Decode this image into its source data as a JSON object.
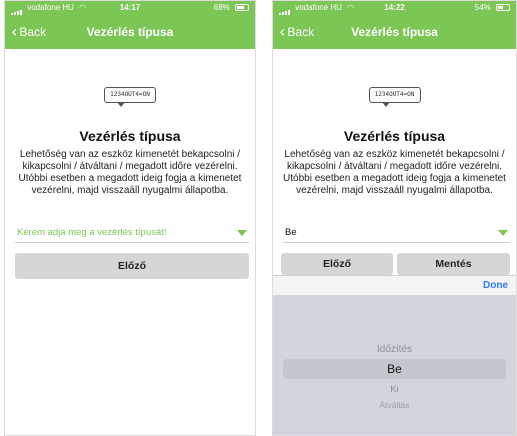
{
  "left": {
    "status": {
      "carrier": "vodafone HU",
      "time": "14:17",
      "battery": "68%",
      "battery_level": 0.68
    },
    "nav": {
      "back_label": "Back",
      "title": "Vezérlés típusa"
    },
    "device_text": "1234OUT4=ON",
    "heading": "Vezérlés típusa",
    "description": "Lehetőség van az eszköz kimenetét bekapcsolni / kikapcsolni / átváltani / megadott időre vezérelni. Utóbbi esetben a megadott ideig fogja a kimenetet vezérelni, majd visszaáll nyugalmi állapotba.",
    "select_placeholder": "Kérem adja meg a vezérlés típusát!",
    "prev_button": "Előző"
  },
  "right": {
    "status": {
      "carrier": "vodafone HU",
      "time": "14:22",
      "battery": "54%",
      "battery_level": 0.54
    },
    "nav": {
      "back_label": "Back",
      "title": "Vezérlés típusa"
    },
    "device_text": "1234OUT4=ON",
    "heading": "Vezérlés típusa",
    "description": "Lehetőség van az eszköz kimenetét bekapcsolni / kikapcsolni / átváltani / megadott időre vezérelni. Utóbbi esetben a megadott ideig fogja a kimenetet vezérelni, majd visszaáll nyugalmi állapotba.",
    "select_value": "Be",
    "prev_button": "Előző",
    "save_button": "Mentés",
    "done_button": "Done",
    "picker_options": [
      "Időzítés",
      "Be",
      "Ki",
      "Átváltás"
    ],
    "picker_selected_index": 1
  },
  "colors": {
    "accent": "#7cc656",
    "done": "#2f7bf5",
    "button_bg": "#d6d6d6",
    "picker_bg": "#d2d5db"
  }
}
